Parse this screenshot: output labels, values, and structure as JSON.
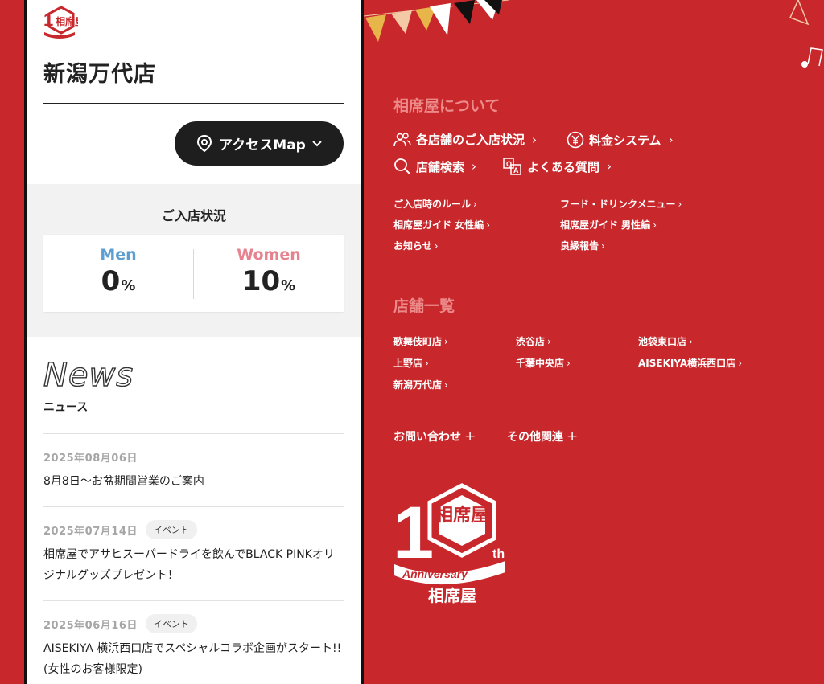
{
  "store": {
    "name": "新潟万代店"
  },
  "logo": {
    "text": "相席屋",
    "anniversary": "Anniversary",
    "number": "10",
    "suffix": "th"
  },
  "access_button": {
    "label": "アクセスMap"
  },
  "status": {
    "title": "ご入店状況",
    "men": {
      "label": "Men",
      "value": "0",
      "unit": "%"
    },
    "women": {
      "label": "Women",
      "value": "10",
      "unit": "%"
    }
  },
  "news": {
    "heading": "News",
    "subheading": "ニュース",
    "items": [
      {
        "date": "2025年08月06日",
        "tag": "",
        "title": "8月8日～お盆期間営業のご案内"
      },
      {
        "date": "2025年07月14日",
        "tag": "イベント",
        "title": "相席屋でアサヒスーパードライを飲んでBLACK PINKオリジナルグッズプレゼント！"
      },
      {
        "date": "2025年06月16日",
        "tag": "イベント",
        "title": "AISEKIYA 横浜西口店でスペシャルコラボ企画がスタート!!(女性のお客様限定)"
      }
    ]
  },
  "footer": {
    "about_title": "相席屋について",
    "main_links": [
      {
        "label": "各店舗のご入店状況"
      },
      {
        "label": "料金システム"
      },
      {
        "label": "店舗検索"
      },
      {
        "label": "よくある質問"
      }
    ],
    "sub_links": [
      {
        "label": "ご入店時のルール"
      },
      {
        "label": "フード・ドリンクメニュー"
      },
      {
        "label": "相席屋ガイド 女性編"
      },
      {
        "label": "相席屋ガイド 男性編"
      },
      {
        "label": "お知らせ"
      },
      {
        "label": "良縁報告"
      }
    ],
    "stores_title": "店舗一覧",
    "stores": [
      {
        "label": "歌舞伎町店"
      },
      {
        "label": "渋谷店"
      },
      {
        "label": "池袋東口店"
      },
      {
        "label": "上野店"
      },
      {
        "label": "千葉中央店"
      },
      {
        "label": "AISEKIYA横浜西口店"
      },
      {
        "label": "新潟万代店"
      }
    ],
    "contact": {
      "label": "お問い合わせ"
    },
    "others": {
      "label": "その他関連"
    }
  },
  "colors": {
    "brand_red": "#c8272b",
    "section_title": "#ec8a8a",
    "men_blue": "#5c9ed0",
    "women_pink": "#e7838f",
    "button_dark": "#1e1e1e"
  },
  "icons": [
    "user-group-icon",
    "yen-icon",
    "search-icon",
    "faq-icon",
    "map-pin-icon",
    "chevron-down-icon",
    "plus-icon"
  ]
}
